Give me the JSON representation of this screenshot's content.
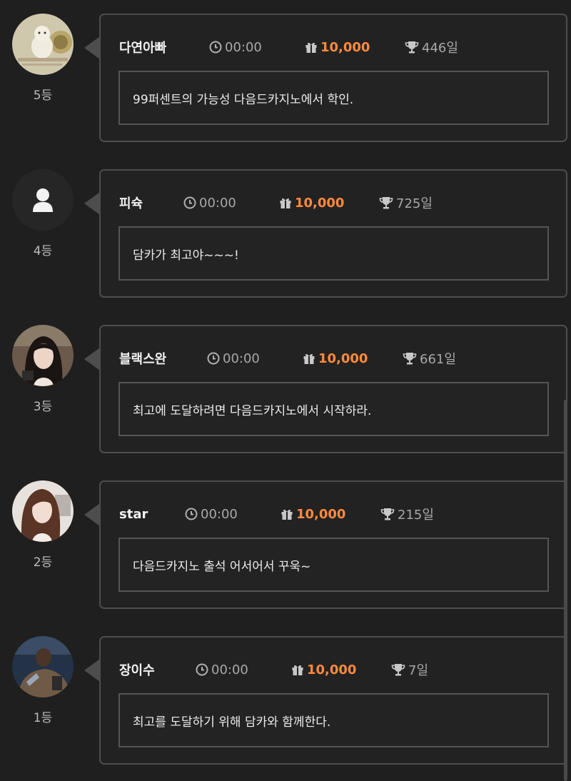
{
  "entries": [
    {
      "rank": "5등",
      "name": "다연아빠",
      "time": "00:00",
      "amount": "10,000",
      "days": "446일",
      "message": "99퍼센트의 가능성 다음드카지노에서 학인.",
      "avatar": "cat-drawing"
    },
    {
      "rank": "4등",
      "name": "피슉",
      "time": "00:00",
      "amount": "10,000",
      "days": "725일",
      "message": "담카가 최고야~~~!",
      "avatar": "default-user-icon"
    },
    {
      "rank": "3등",
      "name": "블랙스완",
      "time": "00:00",
      "amount": "10,000",
      "days": "661일",
      "message": "최고에 도달하려면 다음드카지노에서 시작하라.",
      "avatar": "dark-hair-portrait"
    },
    {
      "rank": "2등",
      "name": "star",
      "time": "00:00",
      "amount": "10,000",
      "days": "215일",
      "message": "다음드카지노 출석 어서어서 꾸욱~",
      "avatar": "brown-hair-portrait"
    },
    {
      "rank": "1등",
      "name": "장이수",
      "time": "00:00",
      "amount": "10,000",
      "days": "7일",
      "message": "최고를 도달하기 위해 담카와 함께한다.",
      "avatar": "movie-still-portrait"
    }
  ],
  "icons": {
    "time": "clock-icon",
    "amount": "gift-icon",
    "days": "trophy-icon"
  },
  "colors": {
    "background": "#1f1f1f",
    "amount": "#ff8a3d",
    "card_border": "#4d4d4d"
  }
}
